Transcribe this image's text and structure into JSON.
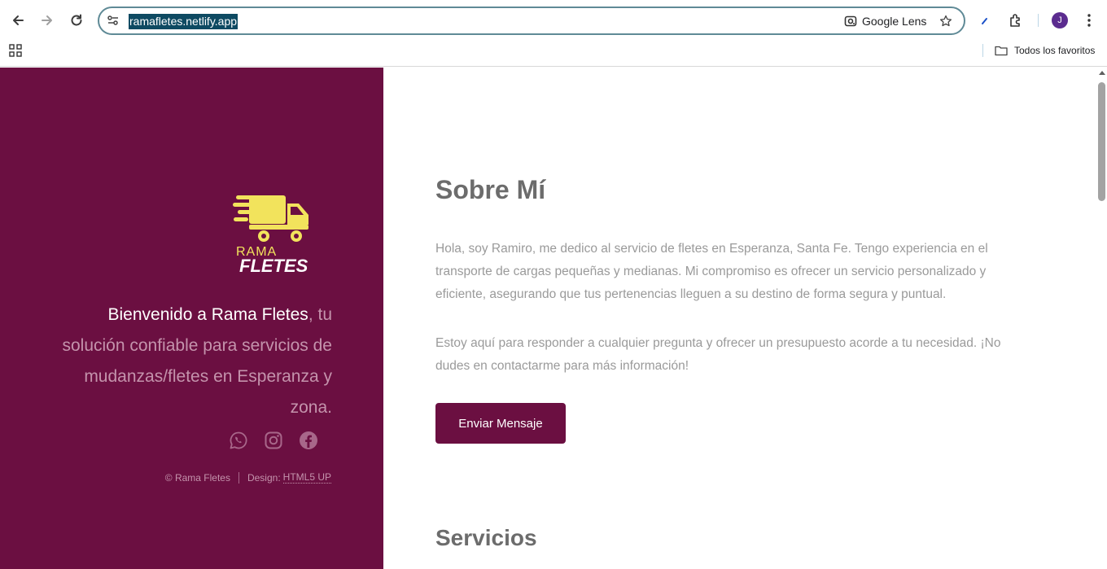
{
  "browser": {
    "url": "ramafletes.netlify.app",
    "lens_label": "Google Lens",
    "avatar_letter": "J",
    "bookmarks_folder": "Todos los favoritos"
  },
  "sidebar": {
    "logo_line1": "RAMA",
    "logo_line2": "FLETES",
    "welcome_strong": "Bienvenido a Rama Fletes",
    "welcome_rest": ", tu solución confiable para servicios de mudanzas/fletes en Esperanza y zona.",
    "copyright": "© Rama Fletes",
    "design_label": "Design:",
    "design_link": "HTML5 UP",
    "social_icons": [
      "whatsapp-icon",
      "instagram-icon",
      "facebook-icon"
    ]
  },
  "main": {
    "about_title": "Sobre Mí",
    "about_p1": "Hola, soy Ramiro, me dedico al servicio de fletes en Esperanza, Santa Fe. Tengo experiencia en el transporte de cargas pequeñas y medianas. Mi compromiso es ofrecer un servicio personalizado y eficiente, asegurando que tus pertenencias lleguen a su destino de forma segura y puntual.",
    "about_p2": "Estoy aquí para responder a cualquier pregunta y ofrecer un presupuesto acorde a tu necesidad. ¡No dudes en contactarme para más información!",
    "send_button": "Enviar Mensaje",
    "services_title": "Servicios"
  },
  "colors": {
    "brand": "#6b0f41",
    "logo_yellow": "#f2e35c",
    "muted_text": "#9a9a9a"
  }
}
